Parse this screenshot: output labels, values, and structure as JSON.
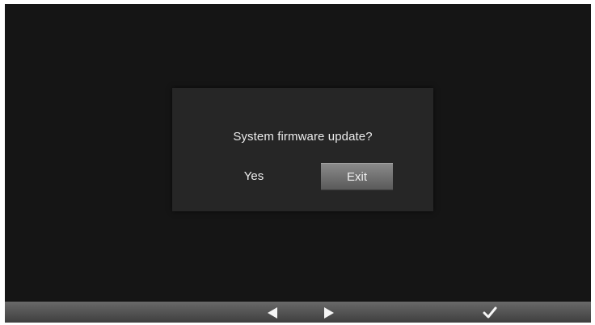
{
  "dialog": {
    "question": "System firmware update?",
    "yes_label": "Yes",
    "exit_label": "Exit"
  },
  "bottom_bar": {
    "icons": [
      "left-arrow-icon",
      "right-arrow-icon",
      "checkmark-icon"
    ]
  },
  "colors": {
    "screen_bg": "#151515",
    "dialog_bg": "#262626",
    "selected_button": "#6f6f6f"
  }
}
